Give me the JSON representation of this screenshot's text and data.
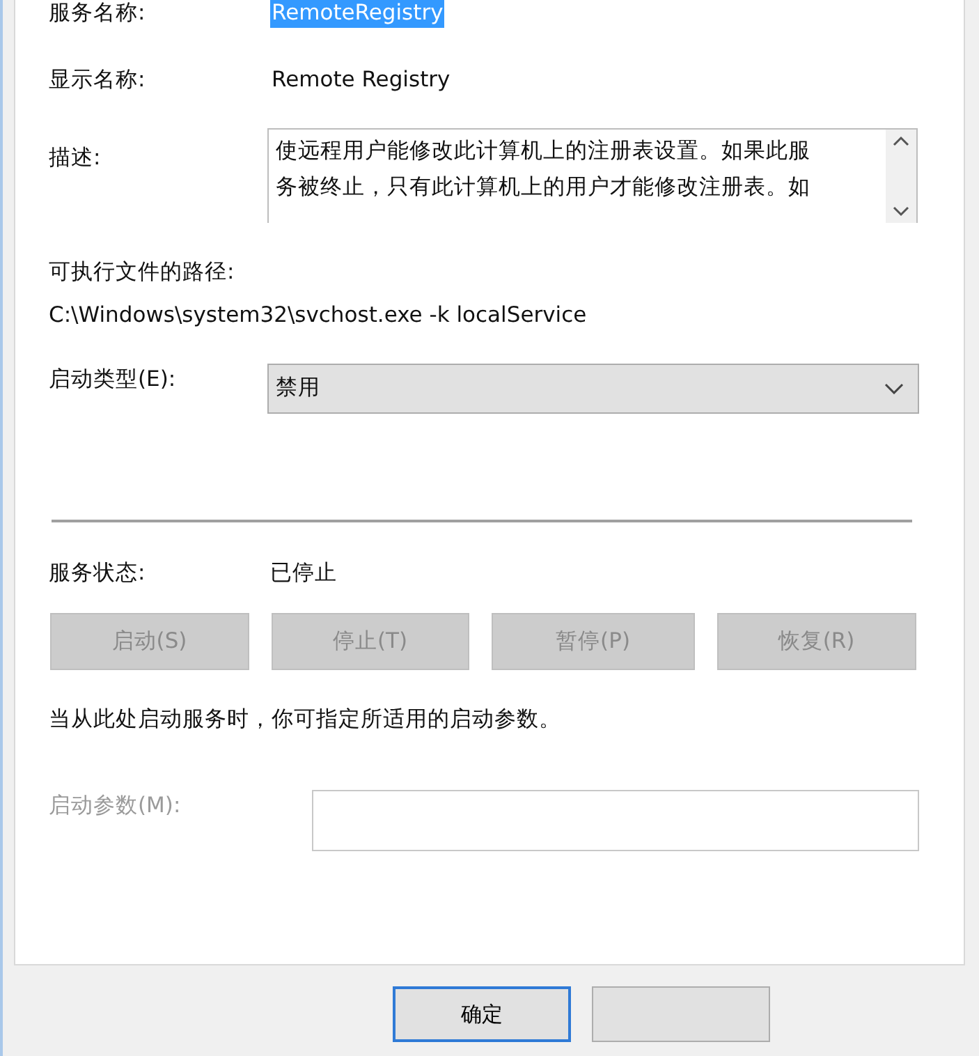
{
  "fields": [
    {
      "kind": "text",
      "label": "服务名称:",
      "value": "RemoteRegistry",
      "highlighted": true
    },
    {
      "kind": "text",
      "label": "显示名称:",
      "value": "Remote Registry",
      "highlighted": false
    },
    {
      "kind": "memo",
      "label": "描述:",
      "lines": [
        "使远程用户能修改此计算机上的注册表设置。如果此服",
        "务被终止，只有此计算机上的用户才能修改注册表。如"
      ]
    },
    {
      "kind": "path",
      "label": "可执行文件的路径:",
      "value": "C:\\Windows\\system32\\svchost.exe -k localService"
    },
    {
      "kind": "combo",
      "label": "启动类型(E):",
      "value": "禁用"
    }
  ],
  "status": {
    "label": "服务状态:",
    "value": "已停止"
  },
  "service_buttons": [
    {
      "label": "启动(S)",
      "disabled": true
    },
    {
      "label": "停止(T)",
      "disabled": true
    },
    {
      "label": "暂停(P)",
      "disabled": true
    },
    {
      "label": "恢复(R)",
      "disabled": true
    }
  ],
  "note": "当从此处启动服务时，你可指定所适用的启动参数。",
  "parameters": {
    "label": "启动参数(M):",
    "disabled": true
  },
  "dialog_buttons": [
    {
      "label": "确定",
      "default": true
    },
    {
      "default": false
    }
  ]
}
